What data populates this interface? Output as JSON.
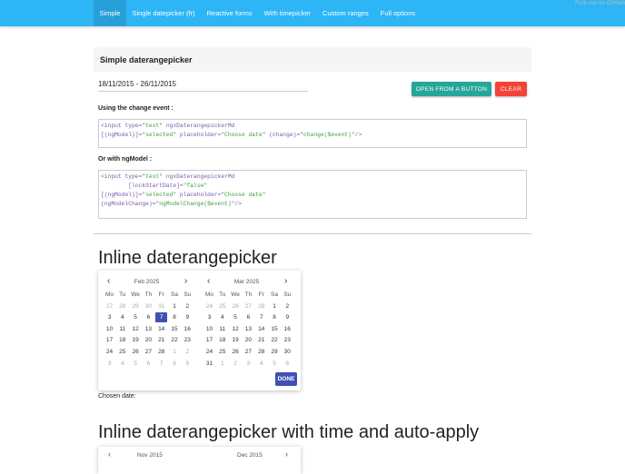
{
  "nav": {
    "items": [
      "Simple",
      "Single datepicker (fr)",
      "Reactive forms",
      "With timepicker",
      "Custom ranges",
      "Full options"
    ],
    "active": 0,
    "github_alt": "Fork me on GitHub"
  },
  "simple": {
    "title": "Simple daterangepicker",
    "value": "18/11/2015 - 26/11/2015",
    "open_button": "OPEN FROM A BUTTON",
    "clear_button": "CLEAR",
    "change_label": "Using the change event :",
    "ngmodel_label": "Or with ngModel :"
  },
  "code1": [
    [
      "<input type=",
      ""
    ],
    [
      "\"text\"",
      "s"
    ],
    [
      " ngxDaterangepickerMd\n[(ngModel)]=",
      ""
    ],
    [
      "\"selected\"",
      "s"
    ],
    [
      " placeholder=",
      ""
    ],
    [
      "\"Choose date\"",
      "s"
    ],
    [
      " (change)=",
      ""
    ],
    [
      "\"change($event)\"",
      "s"
    ],
    [
      "/>",
      ""
    ]
  ],
  "code2": [
    [
      "<input type=",
      ""
    ],
    [
      "\"text\"",
      "s"
    ],
    [
      " ngxDaterangepickerMd\n        [lockStartDate]=",
      ""
    ],
    [
      "\"false\"",
      "s"
    ],
    [
      "\n[(ngModel)]=",
      ""
    ],
    [
      "\"selected\"",
      "s"
    ],
    [
      " placeholder=",
      ""
    ],
    [
      "\"Choose date\"",
      "s"
    ],
    [
      "\n(ngModelChange)=",
      ""
    ],
    [
      "\"ngModelChange($event)\"",
      "s"
    ],
    [
      "/>",
      ""
    ]
  ],
  "inline": {
    "title": "Inline daterangepicker",
    "done": "DONE",
    "chosen_label": "Chosen date:",
    "dow": [
      "Mo",
      "Tu",
      "We",
      "Th",
      "Fr",
      "Sa",
      "Su"
    ],
    "months": [
      {
        "label": "Feb 2025",
        "weeks": [
          [
            27,
            28,
            29,
            30,
            31,
            1,
            2
          ],
          [
            3,
            4,
            5,
            6,
            7,
            8,
            9
          ],
          [
            10,
            11,
            12,
            13,
            14,
            15,
            16
          ],
          [
            17,
            18,
            19,
            20,
            21,
            22,
            23
          ],
          [
            24,
            25,
            26,
            27,
            28,
            1,
            2
          ],
          [
            3,
            4,
            5,
            6,
            7,
            8,
            9
          ]
        ],
        "selected": 7
      },
      {
        "label": "Mar 2025",
        "weeks": [
          [
            24,
            25,
            26,
            27,
            28,
            1,
            2
          ],
          [
            3,
            4,
            5,
            6,
            7,
            8,
            9
          ],
          [
            10,
            11,
            12,
            13,
            14,
            15,
            16
          ],
          [
            17,
            18,
            19,
            20,
            21,
            22,
            23
          ],
          [
            24,
            25,
            26,
            27,
            28,
            29,
            30
          ],
          [
            31,
            1,
            2,
            3,
            4,
            5,
            6
          ]
        ],
        "selected": null
      }
    ]
  },
  "inline_time": {
    "title": "Inline daterangepicker with time and auto-apply",
    "left_month": "Nov 2015",
    "right_month": "Dec 2015"
  },
  "colors": {
    "nav": "#2db5f5",
    "primary": "#3f51b5",
    "teal": "#26a69a",
    "red": "#f44336"
  }
}
